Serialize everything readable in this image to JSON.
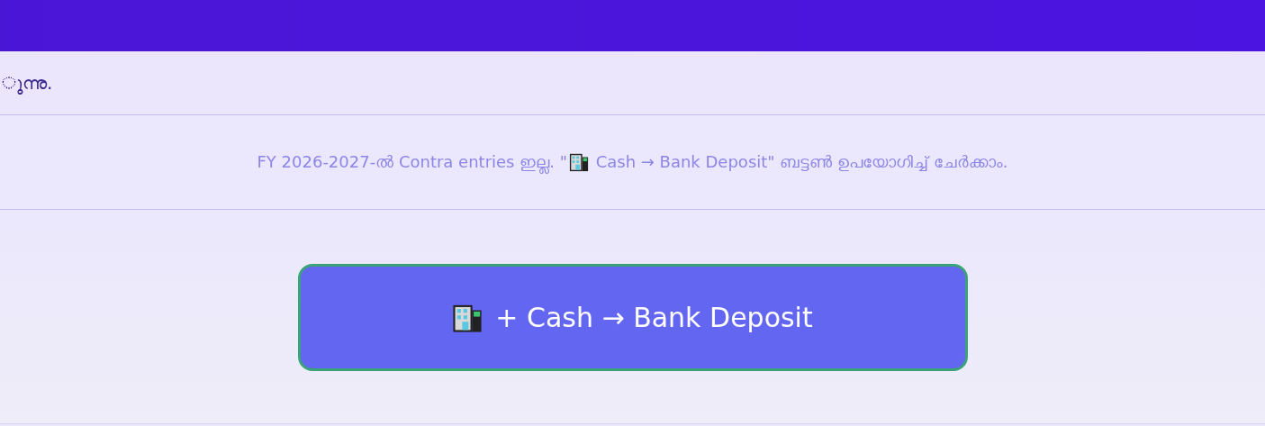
{
  "top_text": "ുന്നു.",
  "empty_message": {
    "before": "FY 2026-2027-ൽ Contra entries ഇല്ല. \"",
    "after": " Cash → Bank Deposit\" ബട്ടൺ ഉപയോഗിച്ച് ചേർക്കാം."
  },
  "deposit_button": {
    "label": "+ Cash → Bank Deposit"
  }
}
